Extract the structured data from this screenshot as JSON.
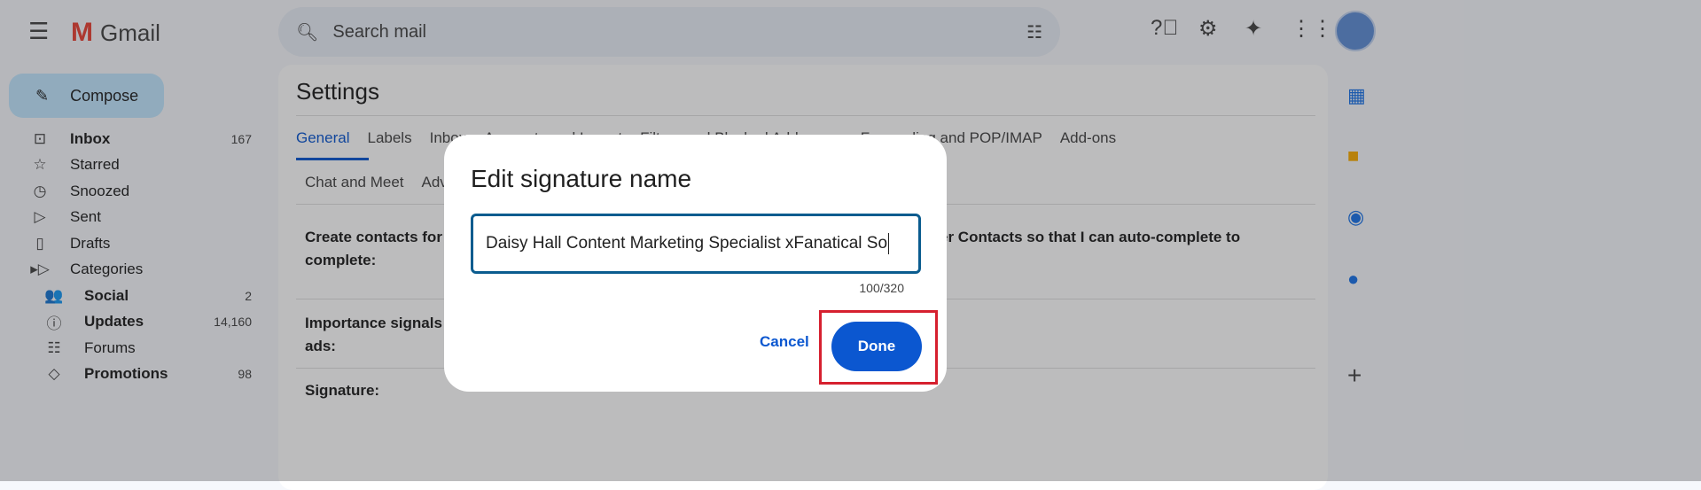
{
  "app": {
    "name": "Gmail"
  },
  "search": {
    "placeholder": "Search mail"
  },
  "compose": "Compose",
  "nav": [
    {
      "label": "Inbox",
      "count": "167",
      "icon": "inbox-icon",
      "glyph": "⊡",
      "bold": true
    },
    {
      "label": "Starred",
      "count": "",
      "icon": "star-icon",
      "glyph": "☆"
    },
    {
      "label": "Snoozed",
      "count": "",
      "icon": "clock-icon",
      "glyph": "◷"
    },
    {
      "label": "Sent",
      "count": "",
      "icon": "send-icon",
      "glyph": "▷"
    },
    {
      "label": "Drafts",
      "count": "",
      "icon": "draft-icon",
      "glyph": "▯"
    },
    {
      "label": "Categories",
      "count": "",
      "icon": "label-icon",
      "glyph": "▸▷"
    }
  ],
  "categories": [
    {
      "label": "Social",
      "count": "2",
      "icon": "people-icon",
      "glyph": "👥",
      "bold": true
    },
    {
      "label": "Updates",
      "count": "14,160",
      "icon": "info-icon",
      "glyph": "ⓘ",
      "bold": true
    },
    {
      "label": "Forums",
      "count": "",
      "icon": "forum-icon",
      "glyph": "☷"
    },
    {
      "label": "Promotions",
      "count": "98",
      "icon": "tag-icon",
      "glyph": "◇",
      "bold": true
    }
  ],
  "settings": {
    "title": "Settings",
    "tabs": [
      "General",
      "Labels",
      "Inbox",
      "Accounts and Import",
      "Filters and Blocked Addresses",
      "Forwarding and POP/IMAP",
      "Add-ons"
    ],
    "tabs2": [
      "Chat and Meet",
      "Advanced"
    ],
    "rows": [
      {
        "label_left": "Create contacts for",
        "label_left2": "complete:",
        "label_right": "er Contacts so that I can auto-complete to"
      },
      {
        "label_left": "Importance signals",
        "label_left2": "ads:"
      },
      {
        "label_left": "Signature:"
      }
    ]
  },
  "dialog": {
    "title": "Edit signature name",
    "value": "Daisy Hall Content Marketing Specialist xFanatical So",
    "counter": "100/320",
    "cancel": "Cancel",
    "done": "Done",
    "highlight_color": "#d6202f"
  }
}
